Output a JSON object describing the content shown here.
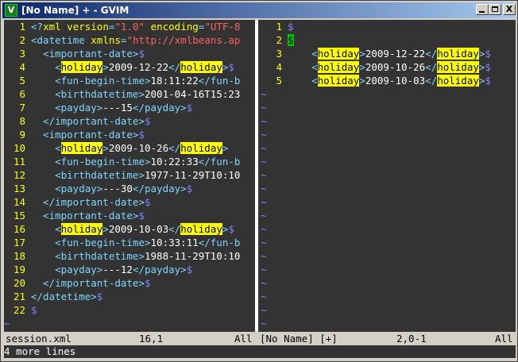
{
  "window": {
    "title": "[No Name] + - GVIM",
    "app_icon": "gvim-icon",
    "controls": {
      "minimize": "_",
      "maximize": "□",
      "close": "X"
    }
  },
  "colors": {
    "background": "#333333",
    "line_number": "#ffff00",
    "tag": "#7fd6ff",
    "attribute": "#ffff00",
    "string": "#ff6060",
    "eol_marker": "#8080ff",
    "search_highlight": "#ffff00",
    "cursor": "#00c000",
    "statusline_bg": "#d4d0c8"
  },
  "left_pane": {
    "lines": [
      {
        "num": "1",
        "tokens": [
          {
            "t": "<?",
            "c": "tag"
          },
          {
            "t": "xml version",
            "c": "attr"
          },
          {
            "t": "=",
            "c": "tag"
          },
          {
            "t": "\"1.0\"",
            "c": "str"
          },
          {
            "t": " ",
            "c": "txt"
          },
          {
            "t": "encoding",
            "c": "attr"
          },
          {
            "t": "=",
            "c": "tag"
          },
          {
            "t": "\"UTF-8",
            "c": "str"
          }
        ]
      },
      {
        "num": "2",
        "tokens": [
          {
            "t": "<datetime ",
            "c": "tag"
          },
          {
            "t": "xmlns",
            "c": "attr"
          },
          {
            "t": "=",
            "c": "tag"
          },
          {
            "t": "\"http://xmlbeans.ap",
            "c": "str"
          }
        ]
      },
      {
        "num": "3",
        "tokens": [
          {
            "t": "  <important-date>",
            "c": "tag"
          },
          {
            "t": "$",
            "c": "eol"
          }
        ]
      },
      {
        "num": "4",
        "tokens": [
          {
            "t": "    <",
            "c": "tag"
          },
          {
            "t": "holiday",
            "c": "hl"
          },
          {
            "t": ">",
            "c": "tag"
          },
          {
            "t": "2009-12-22",
            "c": "txt"
          },
          {
            "t": "</",
            "c": "tag"
          },
          {
            "t": "holiday",
            "c": "hl"
          },
          {
            "t": ">",
            "c": "tag"
          },
          {
            "t": "$",
            "c": "eol"
          }
        ]
      },
      {
        "num": "5",
        "tokens": [
          {
            "t": "    <fun-begin-time>",
            "c": "tag"
          },
          {
            "t": "18:11:22",
            "c": "txt"
          },
          {
            "t": "</fun-b",
            "c": "tag"
          }
        ]
      },
      {
        "num": "6",
        "tokens": [
          {
            "t": "    <birthdatetime>",
            "c": "tag"
          },
          {
            "t": "2001-04-16T15:23",
            "c": "txt"
          }
        ]
      },
      {
        "num": "7",
        "tokens": [
          {
            "t": "    <payday>",
            "c": "tag"
          },
          {
            "t": "---15",
            "c": "txt"
          },
          {
            "t": "</payday>",
            "c": "tag"
          },
          {
            "t": "$",
            "c": "eol"
          }
        ]
      },
      {
        "num": "8",
        "tokens": [
          {
            "t": "  </important-date>",
            "c": "tag"
          },
          {
            "t": "$",
            "c": "eol"
          }
        ]
      },
      {
        "num": "9",
        "tokens": [
          {
            "t": "  <important-date>",
            "c": "tag"
          },
          {
            "t": "$",
            "c": "eol"
          }
        ]
      },
      {
        "num": "10",
        "tokens": [
          {
            "t": "    <",
            "c": "tag"
          },
          {
            "t": "holiday",
            "c": "hl"
          },
          {
            "t": ">",
            "c": "tag"
          },
          {
            "t": "2009-10-26",
            "c": "txt"
          },
          {
            "t": "</",
            "c": "tag"
          },
          {
            "t": "holiday",
            "c": "hl"
          },
          {
            "t": ">",
            "c": "tag"
          }
        ]
      },
      {
        "num": "11",
        "tokens": [
          {
            "t": "    <fun-begin-time>",
            "c": "tag"
          },
          {
            "t": "10:22:33",
            "c": "txt"
          },
          {
            "t": "</fun-b",
            "c": "tag"
          }
        ]
      },
      {
        "num": "12",
        "tokens": [
          {
            "t": "    <birthdatetime>",
            "c": "tag"
          },
          {
            "t": "1977-11-29T10:10",
            "c": "txt"
          }
        ]
      },
      {
        "num": "13",
        "tokens": [
          {
            "t": "    <payday>",
            "c": "tag"
          },
          {
            "t": "---30",
            "c": "txt"
          },
          {
            "t": "</payday>",
            "c": "tag"
          },
          {
            "t": "$",
            "c": "eol"
          }
        ]
      },
      {
        "num": "14",
        "tokens": [
          {
            "t": "  </important-date>",
            "c": "tag"
          },
          {
            "t": "$",
            "c": "eol"
          }
        ]
      },
      {
        "num": "15",
        "tokens": [
          {
            "t": "  <important-date>",
            "c": "tag"
          },
          {
            "t": "$",
            "c": "eol"
          }
        ]
      },
      {
        "num": "16",
        "tokens": [
          {
            "t": "    <",
            "c": "tag"
          },
          {
            "t": "holiday",
            "c": "hl"
          },
          {
            "t": ">",
            "c": "tag"
          },
          {
            "t": "2009-10-03",
            "c": "txt"
          },
          {
            "t": "</",
            "c": "tag"
          },
          {
            "t": "holiday",
            "c": "hl"
          },
          {
            "t": ">",
            "c": "tag"
          },
          {
            "t": "$",
            "c": "eol"
          }
        ]
      },
      {
        "num": "17",
        "tokens": [
          {
            "t": "    <fun-begin-time>",
            "c": "tag"
          },
          {
            "t": "10:33:11",
            "c": "txt"
          },
          {
            "t": "</fun-b",
            "c": "tag"
          }
        ]
      },
      {
        "num": "18",
        "tokens": [
          {
            "t": "    <birthdatetime>",
            "c": "tag"
          },
          {
            "t": "1988-11-29T10:10",
            "c": "txt"
          }
        ]
      },
      {
        "num": "19",
        "tokens": [
          {
            "t": "    <payday>",
            "c": "tag"
          },
          {
            "t": "---12",
            "c": "txt"
          },
          {
            "t": "</payday>",
            "c": "tag"
          },
          {
            "t": "$",
            "c": "eol"
          }
        ]
      },
      {
        "num": "20",
        "tokens": [
          {
            "t": "  </important-date>",
            "c": "tag"
          },
          {
            "t": "$",
            "c": "eol"
          }
        ]
      },
      {
        "num": "21",
        "tokens": [
          {
            "t": "</datetime>",
            "c": "tag"
          },
          {
            "t": "$",
            "c": "eol"
          }
        ]
      },
      {
        "num": "22",
        "tokens": [
          {
            "t": "$",
            "c": "eol"
          }
        ]
      }
    ],
    "filler": [
      "~"
    ],
    "status": {
      "file": "session.xml",
      "position": "16,1",
      "scroll": "All"
    }
  },
  "right_pane": {
    "lines": [
      {
        "num": "1",
        "tokens": [
          {
            "t": "$",
            "c": "eol"
          }
        ]
      },
      {
        "num": "2",
        "tokens": [
          {
            "t": "$",
            "c": "cursor"
          }
        ]
      },
      {
        "num": "3",
        "tokens": [
          {
            "t": "    <",
            "c": "tag"
          },
          {
            "t": "holiday",
            "c": "hl"
          },
          {
            "t": ">",
            "c": "tag"
          },
          {
            "t": "2009-12-22",
            "c": "txt"
          },
          {
            "t": "</",
            "c": "tag"
          },
          {
            "t": "holiday",
            "c": "hl"
          },
          {
            "t": ">",
            "c": "tag"
          },
          {
            "t": "$",
            "c": "eol"
          }
        ]
      },
      {
        "num": "4",
        "tokens": [
          {
            "t": "    <",
            "c": "tag"
          },
          {
            "t": "holiday",
            "c": "hl"
          },
          {
            "t": ">",
            "c": "tag"
          },
          {
            "t": "2009-10-26",
            "c": "txt"
          },
          {
            "t": "</",
            "c": "tag"
          },
          {
            "t": "holiday",
            "c": "hl"
          },
          {
            "t": ">",
            "c": "tag"
          },
          {
            "t": "$",
            "c": "eol"
          }
        ]
      },
      {
        "num": "5",
        "tokens": [
          {
            "t": "    <",
            "c": "tag"
          },
          {
            "t": "holiday",
            "c": "hl"
          },
          {
            "t": ">",
            "c": "tag"
          },
          {
            "t": "2009-10-03",
            "c": "txt"
          },
          {
            "t": "</",
            "c": "tag"
          },
          {
            "t": "holiday",
            "c": "hl"
          },
          {
            "t": ">",
            "c": "tag"
          },
          {
            "t": "$",
            "c": "eol"
          }
        ]
      }
    ],
    "filler": [
      "~",
      "~",
      "~",
      "~",
      "~",
      "~",
      "~",
      "~",
      "~",
      "~",
      "~",
      "~",
      "~",
      "~",
      "~",
      "~",
      "~",
      "~"
    ],
    "status": {
      "file": "[No Name] [+]",
      "position": "2,0-1",
      "scroll": "All"
    }
  },
  "cmdline": "4 more lines"
}
